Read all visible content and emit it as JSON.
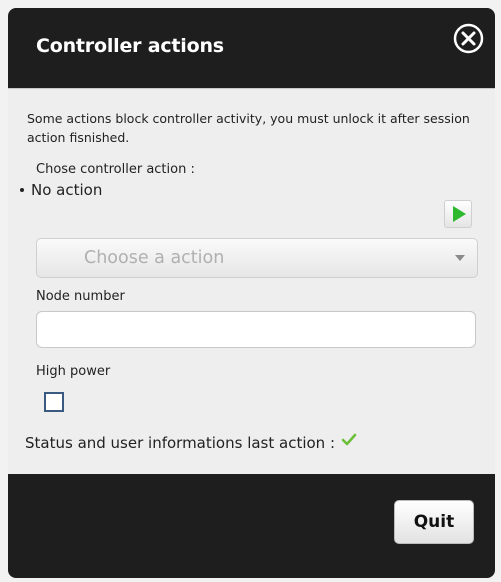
{
  "dialog": {
    "title": "Controller actions",
    "close_icon": "close-circle-icon"
  },
  "content": {
    "info_text": "Some actions block controller activity, you must unlock it after session action fisnished.",
    "choose_label": "Chose controller action :",
    "current_action": "No action",
    "run_icon": "play-icon",
    "select": {
      "placeholder": "Choose a action"
    },
    "node_label": "Node number",
    "node_value": "",
    "high_power_label": "High power",
    "high_power_checked": false,
    "status_label": "Status and user informations last action :",
    "status_icon": "checkmark-icon"
  },
  "footer": {
    "quit_label": "Quit"
  },
  "colors": {
    "header_bg": "#1e1e1e",
    "content_bg": "#eeeeee",
    "play_green": "#2db82d",
    "check_green": "#6cbf3a",
    "checkbox_border": "#3b5a82"
  }
}
